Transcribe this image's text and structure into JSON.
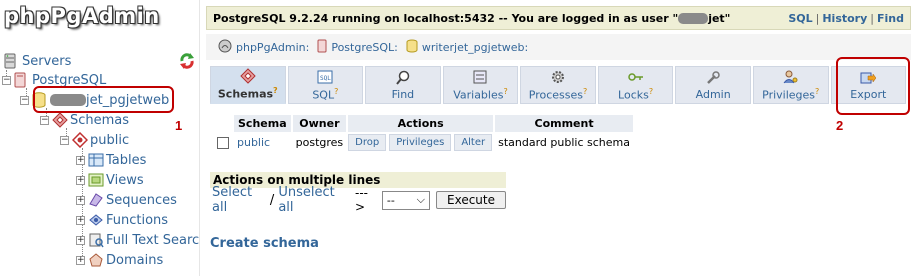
{
  "sidebar": {
    "logo": "phpPgAdmin",
    "servers": "Servers",
    "server": "PostgreSQL",
    "database_suffix": "jet_pgjetweb",
    "schemas": "Schemas",
    "schema": "public",
    "children": [
      "Tables",
      "Views",
      "Sequences",
      "Functions",
      "Full Text Searc",
      "Domains"
    ],
    "annotation": "1"
  },
  "topbar": {
    "status_prefix": "PostgreSQL 9.2.24 running on localhost:5432 -- You are logged in as user \"",
    "status_suffix": "jet\"",
    "links": [
      "SQL",
      "History",
      "Find"
    ]
  },
  "trail": {
    "app": "phpPgAdmin:",
    "server": "PostgreSQL:",
    "database": "writerjet_pgjetweb:"
  },
  "tabs": [
    {
      "label": "Schemas",
      "icon": "schemas-icon",
      "help": true,
      "active": true
    },
    {
      "label": "SQL",
      "icon": "sql-icon",
      "help": true
    },
    {
      "label": "Find",
      "icon": "find-icon",
      "help": false
    },
    {
      "label": "Variables",
      "icon": "variables-icon",
      "help": true
    },
    {
      "label": "Processes",
      "icon": "processes-icon",
      "help": true
    },
    {
      "label": "Locks",
      "icon": "locks-icon",
      "help": true
    },
    {
      "label": "Admin",
      "icon": "admin-icon",
      "help": false
    },
    {
      "label": "Privileges",
      "icon": "privileges-icon",
      "help": true
    },
    {
      "label": "Export",
      "icon": "export-icon",
      "help": false
    }
  ],
  "export_annotation": "2",
  "table": {
    "headers": [
      "Schema",
      "Owner",
      "Actions",
      "Comment"
    ],
    "row": {
      "schema": "public",
      "owner": "postgres",
      "actions": [
        "Drop",
        "Privileges",
        "Alter"
      ],
      "comment": "standard public schema"
    }
  },
  "multi": {
    "title": "Actions on multiple lines",
    "select_all": "Select all",
    "slash": "/",
    "unselect_all": "Unselect all",
    "arrow": "--->",
    "select_value": "--",
    "execute": "Execute"
  },
  "create_schema": "Create schema",
  "colors": {
    "link": "#336699",
    "annotation": "#c00000",
    "topbar_bg": "#efefd6",
    "tab_bg": "#e4e8f0"
  }
}
